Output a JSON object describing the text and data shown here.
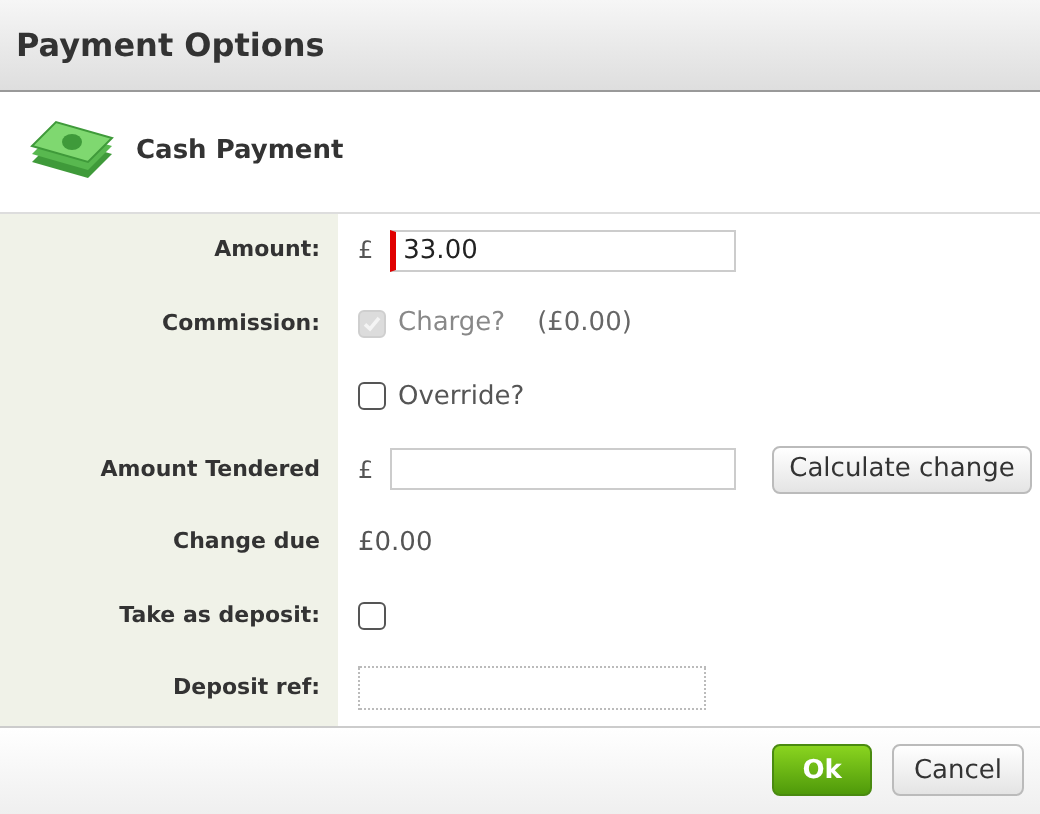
{
  "window": {
    "title": "Payment Options"
  },
  "section": {
    "title": "Cash Payment"
  },
  "rows": [
    {
      "kind": "input",
      "label": "Amount:",
      "currency": "£",
      "value": "33.00",
      "invalid": true
    },
    {
      "kind": "checkbox",
      "label": "Commission:",
      "option": "Charge?",
      "checked": true,
      "disabled": true,
      "note": "(£0.00)"
    },
    {
      "kind": "checkbox",
      "option": "Override?",
      "checked": false,
      "disabled": false
    },
    {
      "kind": "input",
      "label": "Amount Tendered",
      "currency": "£",
      "invalid": false,
      "button": "Calculate change"
    },
    {
      "kind": "text",
      "label": "Change due",
      "value": "£0.00"
    },
    {
      "kind": "checkbox",
      "label": "Take as deposit:",
      "checked": false,
      "disabled": false
    },
    {
      "kind": "ref",
      "label": "Deposit ref:"
    }
  ],
  "buttons": [
    {
      "label": "Ok",
      "primary": true
    },
    {
      "label": "Cancel",
      "primary": false
    }
  ]
}
